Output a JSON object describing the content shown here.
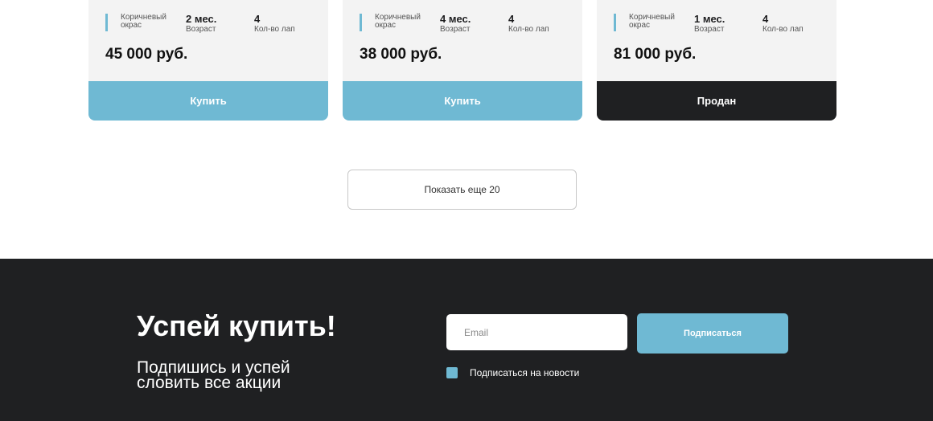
{
  "cards": [
    {
      "color_label": "Коричневый окрас",
      "age_value": "2 мес.",
      "age_label": "Возраст",
      "legs_value": "4",
      "legs_label": "Кол-во лап",
      "price": "45 000 руб.",
      "button_label": "Купить",
      "status": "available"
    },
    {
      "color_label": "Коричневый окрас",
      "age_value": "4 мес.",
      "age_label": "Возраст",
      "legs_value": "4",
      "legs_label": "Кол-во лап",
      "price": "38 000 руб.",
      "button_label": "Купить",
      "status": "available"
    },
    {
      "color_label": "Коричневый окрас",
      "age_value": "1 мес.",
      "age_label": "Возраст",
      "legs_value": "4",
      "legs_label": "Кол-во лап",
      "price": "81 000 руб.",
      "button_label": "Продан",
      "status": "sold"
    }
  ],
  "show_more": {
    "label": "Показать еще 20"
  },
  "footer": {
    "title": "Успей купить!",
    "subtitle": "Подпишись и успей словить все акции",
    "email_placeholder": "Email",
    "email_value": "",
    "subscribe_label": "Подписаться",
    "checkbox_label": "Подписаться на новости",
    "checkbox_checked": true
  },
  "colors": {
    "accent": "#6fb9d3",
    "dark": "#1f2022",
    "card_bg": "#f3f3f3"
  }
}
